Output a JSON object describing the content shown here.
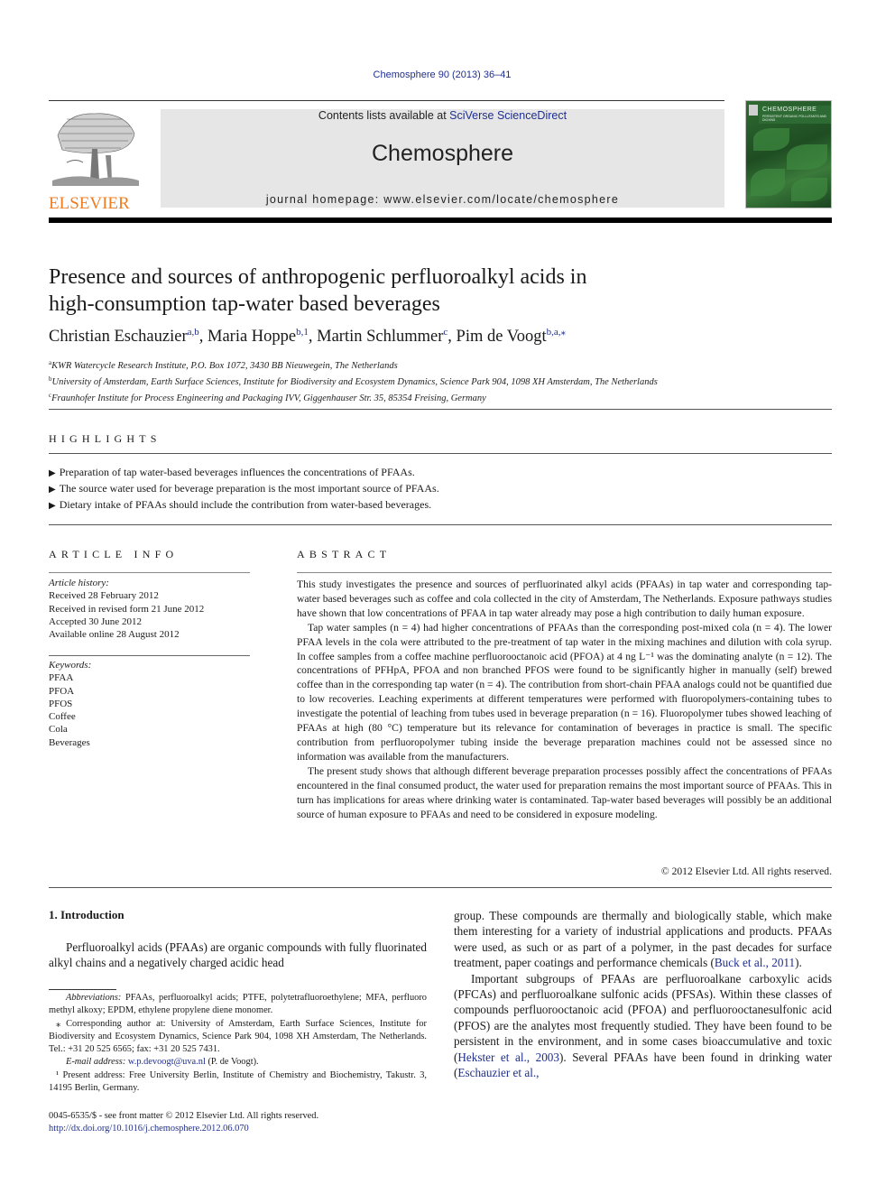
{
  "header": {
    "citation": "Chemosphere 90 (2013) 36–41",
    "contents_prefix": "Contents lists available at ",
    "contents_link": "SciVerse ScienceDirect",
    "journal_name": "Chemosphere",
    "homepage": "journal homepage: www.elsevier.com/locate/chemosphere",
    "publisher_wordmark": "ELSEVIER",
    "cover_title": "CHEMOSPHERE",
    "cover_subtitle": "PERSISTENT ORGANIC POLLUTANTS AND DIOXINS",
    "brand_color": "#f07c21",
    "link_color": "#1f2f8f"
  },
  "article": {
    "title_line1": "Presence and sources of anthropogenic perfluoroalkyl acids in",
    "title_line2": "high-consumption tap-water based beverages",
    "authors": [
      {
        "name": "Christian Eschauzier",
        "sup": "a,b",
        "sep": ", "
      },
      {
        "name": "Maria Hoppe",
        "sup": "b,1",
        "sep": ", "
      },
      {
        "name": "Martin Schlummer",
        "sup": "c",
        "sep": ", "
      },
      {
        "name": "Pim de Voogt",
        "sup": "b,a,⁎",
        "sep": ""
      }
    ],
    "affiliations": [
      {
        "mark": "a",
        "text": "KWR Watercycle Research Institute, P.O. Box 1072, 3430 BB Nieuwegein, The Netherlands"
      },
      {
        "mark": "b",
        "text": "University of Amsterdam, Earth Surface Sciences, Institute for Biodiversity and Ecosystem Dynamics, Science Park 904, 1098 XH Amsterdam, The Netherlands"
      },
      {
        "mark": "c",
        "text": "Fraunhofer Institute for Process Engineering and Packaging IVV, Giggenhauser Str. 35, 85354 Freising, Germany"
      }
    ]
  },
  "highlights": {
    "heading": "HIGHLIGHTS",
    "items": [
      "Preparation of tap water-based beverages influences the concentrations of PFAAs.",
      "The source water used for beverage preparation is the most important source of PFAAs.",
      "Dietary intake of PFAAs should include the contribution from water-based beverages."
    ]
  },
  "article_info": {
    "heading": "ARTICLE INFO",
    "history_label": "Article history:",
    "history": [
      "Received 28 February 2012",
      "Received in revised form 21 June 2012",
      "Accepted 30 June 2012",
      "Available online 28 August 2012"
    ],
    "keywords_label": "Keywords:",
    "keywords": [
      "PFAA",
      "PFOA",
      "PFOS",
      "Coffee",
      "Cola",
      "Beverages"
    ]
  },
  "abstract": {
    "heading": "ABSTRACT",
    "paragraphs": [
      "This study investigates the presence and sources of perfluorinated alkyl acids (PFAAs) in tap water and corresponding tap-water based beverages such as coffee and cola collected in the city of Amsterdam, The Netherlands. Exposure pathways studies have shown that low concentrations of PFAA in tap water already may pose a high contribution to daily human exposure.",
      "Tap water samples (n = 4) had higher concentrations of PFAAs than the corresponding post-mixed cola (n = 4). The lower PFAA levels in the cola were attributed to the pre-treatment of tap water in the mixing machines and dilution with cola syrup. In coffee samples from a coffee machine perfluorooctanoic acid (PFOA) at 4 ng L⁻¹ was the dominating analyte (n = 12). The concentrations of PFHpA, PFOA and non branched PFOS were found to be significantly higher in manually (self) brewed coffee than in the corresponding tap water (n = 4). The contribution from short-chain PFAA analogs could not be quantified due to low recoveries. Leaching experiments at different temperatures were performed with fluoropolymers-containing tubes to investigate the potential of leaching from tubes used in beverage preparation (n = 16). Fluoropolymer tubes showed leaching of PFAAs at high (80 °C) temperature but its relevance for contamination of beverages in practice is small. The specific contribution from perfluoropolymer tubing inside the beverage preparation machines could not be assessed since no information was available from the manufacturers.",
      "The present study shows that although different beverage preparation processes possibly affect the concentrations of PFAAs encountered in the final consumed product, the water used for preparation remains the most important source of PFAAs. This in turn has implications for areas where drinking water is contaminated. Tap-water based beverages will possibly be an additional source of human exposure to PFAAs and need to be considered in exposure modeling."
    ],
    "copyright": "© 2012 Elsevier Ltd. All rights reserved."
  },
  "introduction": {
    "heading": "1. Introduction",
    "left_paragraph": "Perfluoroalkyl acids (PFAAs) are organic compounds with fully fluorinated alkyl chains and a negatively charged acidic head",
    "right_p1_text": "group. These compounds are thermally and biologically stable, which make them interesting for a variety of industrial applications and products. PFAAs were used, as such or as part of a polymer, in the past decades for surface treatment, paper coatings and performance chemicals (",
    "right_p1_ref": "Buck et al., 2011",
    "right_p1_end": ").",
    "right_p2_text": "Important subgroups of PFAAs are perfluoroalkane carboxylic acids (PFCAs) and perfluoroalkane sulfonic acids (PFSAs). Within these classes of compounds perfluorooctanoic acid (PFOA) and perfluorooctanesulfonic acid (PFOS) are the analytes most frequently studied. They have been found to be persistent in the environment, and in some cases bioaccumulative and toxic (",
    "right_p2_ref1": "Hekster et al., 2003",
    "right_p2_mid": "). Several PFAAs have been found in drinking water (",
    "right_p2_ref2": "Eschauzier et al.,"
  },
  "footnotes": {
    "abbrev_label": "Abbreviations:",
    "abbrev_text": " PFAAs, perfluoroalkyl acids; PTFE, polytetrafluoroethylene; MFA, perfluoro methyl alkoxy; EPDM, ethylene propylene diene monomer.",
    "corresponding": "⁎ Corresponding author at: University of Amsterdam, Earth Surface Sciences, Institute for Biodiversity and Ecosystem Dynamics, Science Park 904, 1098 XH Amsterdam, The Netherlands. Tel.: +31 20 525 6565; fax: +31 20 525 7431.",
    "email_label": "E-mail address:",
    "email": "w.p.devoogt@uva.nl",
    "email_suffix": " (P. de Voogt).",
    "present_address": "¹ Present address: Free University Berlin, Institute of Chemistry and Biochemistry, Takustr. 3, 14195 Berlin, Germany.",
    "front_matter": "0045-6535/$ - see front matter © 2012 Elsevier Ltd. All rights reserved.",
    "doi": "http://dx.doi.org/10.1016/j.chemosphere.2012.06.070"
  }
}
